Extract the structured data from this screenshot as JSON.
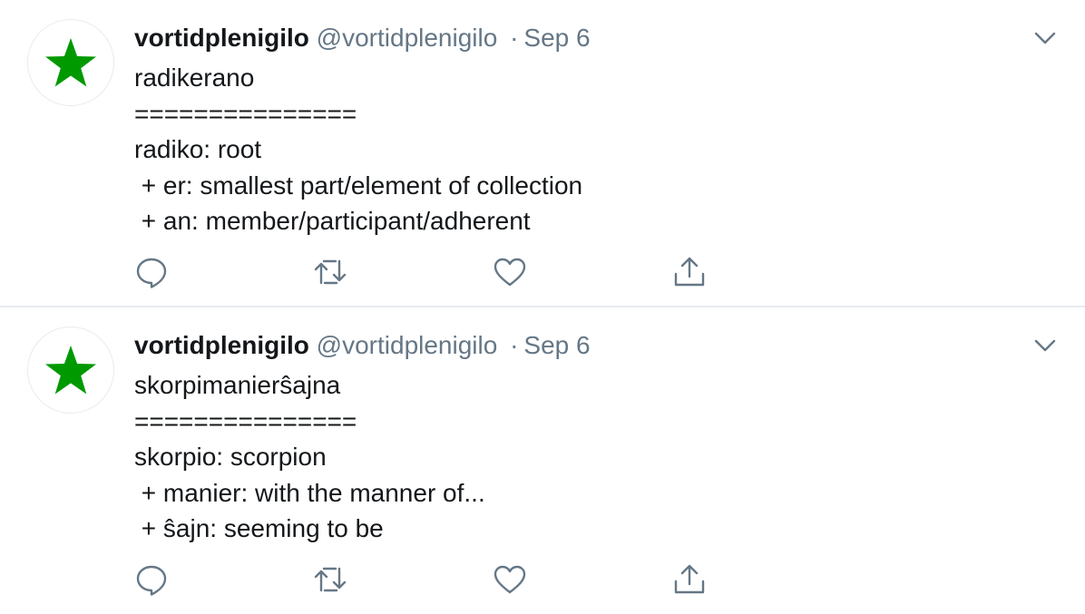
{
  "colors": {
    "star_green": "#009900",
    "icon_gray": "#657786",
    "divider": "#e6ecf0"
  },
  "tweets": [
    {
      "author_name": "vortidplenigilo",
      "author_handle": "@vortidplenigilo",
      "separator": "·",
      "date": "Sep 6",
      "avatar_icon": "green-star-icon",
      "lines": [
        "radikerano",
        "===============",
        "radiko: root",
        " + er: smallest part/element of collection",
        " + an: member/participant/adherent"
      ],
      "actions": [
        "reply-icon",
        "retweet-icon",
        "like-icon",
        "share-icon"
      ]
    },
    {
      "author_name": "vortidplenigilo",
      "author_handle": "@vortidplenigilo",
      "separator": "·",
      "date": "Sep 6",
      "avatar_icon": "green-star-icon",
      "lines": [
        "skorpimanierŝajna",
        "===============",
        "skorpio: scorpion",
        " + manier: with the manner of...",
        " + ŝajn: seeming to be"
      ],
      "actions": [
        "reply-icon",
        "retweet-icon",
        "like-icon",
        "share-icon"
      ]
    }
  ]
}
